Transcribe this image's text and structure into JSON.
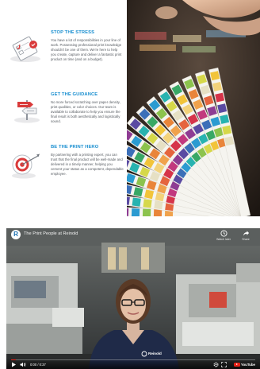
{
  "features": [
    {
      "icon": "checklist-icon",
      "title": "STOP THE STRESS",
      "body": "You have a lot of responsibilities in your line of work. Possessing professional print knowledge shouldn't be one of them. We're here to help you create, capture and deliver a fantastic print product on time (and on a budget)."
    },
    {
      "icon": "signpost-icon",
      "title": "GET THE GUIDANCE",
      "body": "No more forced scratching over paper density, print qualities, or color choices. Our team is available to collaborate to help you ensure the final result is both aesthetically and logistically sound."
    },
    {
      "icon": "target-icon",
      "title": "BE THE PRINT HERO",
      "body": "By partnering with a printing expert, you can trust that the final product will be well-made and delivered in a timely manner, helping you cement your status as a competent, dependable employee."
    }
  ],
  "photo": {
    "subject": "color-swatch-fan"
  },
  "video": {
    "channel_logo_letter": "R",
    "title": "The Print People at Reinold",
    "actions": [
      {
        "label": "Watch later",
        "icon": "clock-icon"
      },
      {
        "label": "Share",
        "icon": "share-icon"
      }
    ],
    "progress": 0.02,
    "time": "0:00 / 0:37",
    "youtube_label": "YouTube",
    "shirt_logo": "Reinold"
  },
  "colors": {
    "accent_blue": "#1a8fd0",
    "body_text": "#555a60",
    "icon_red": "#d93a3a",
    "progress_red": "#e62117"
  }
}
